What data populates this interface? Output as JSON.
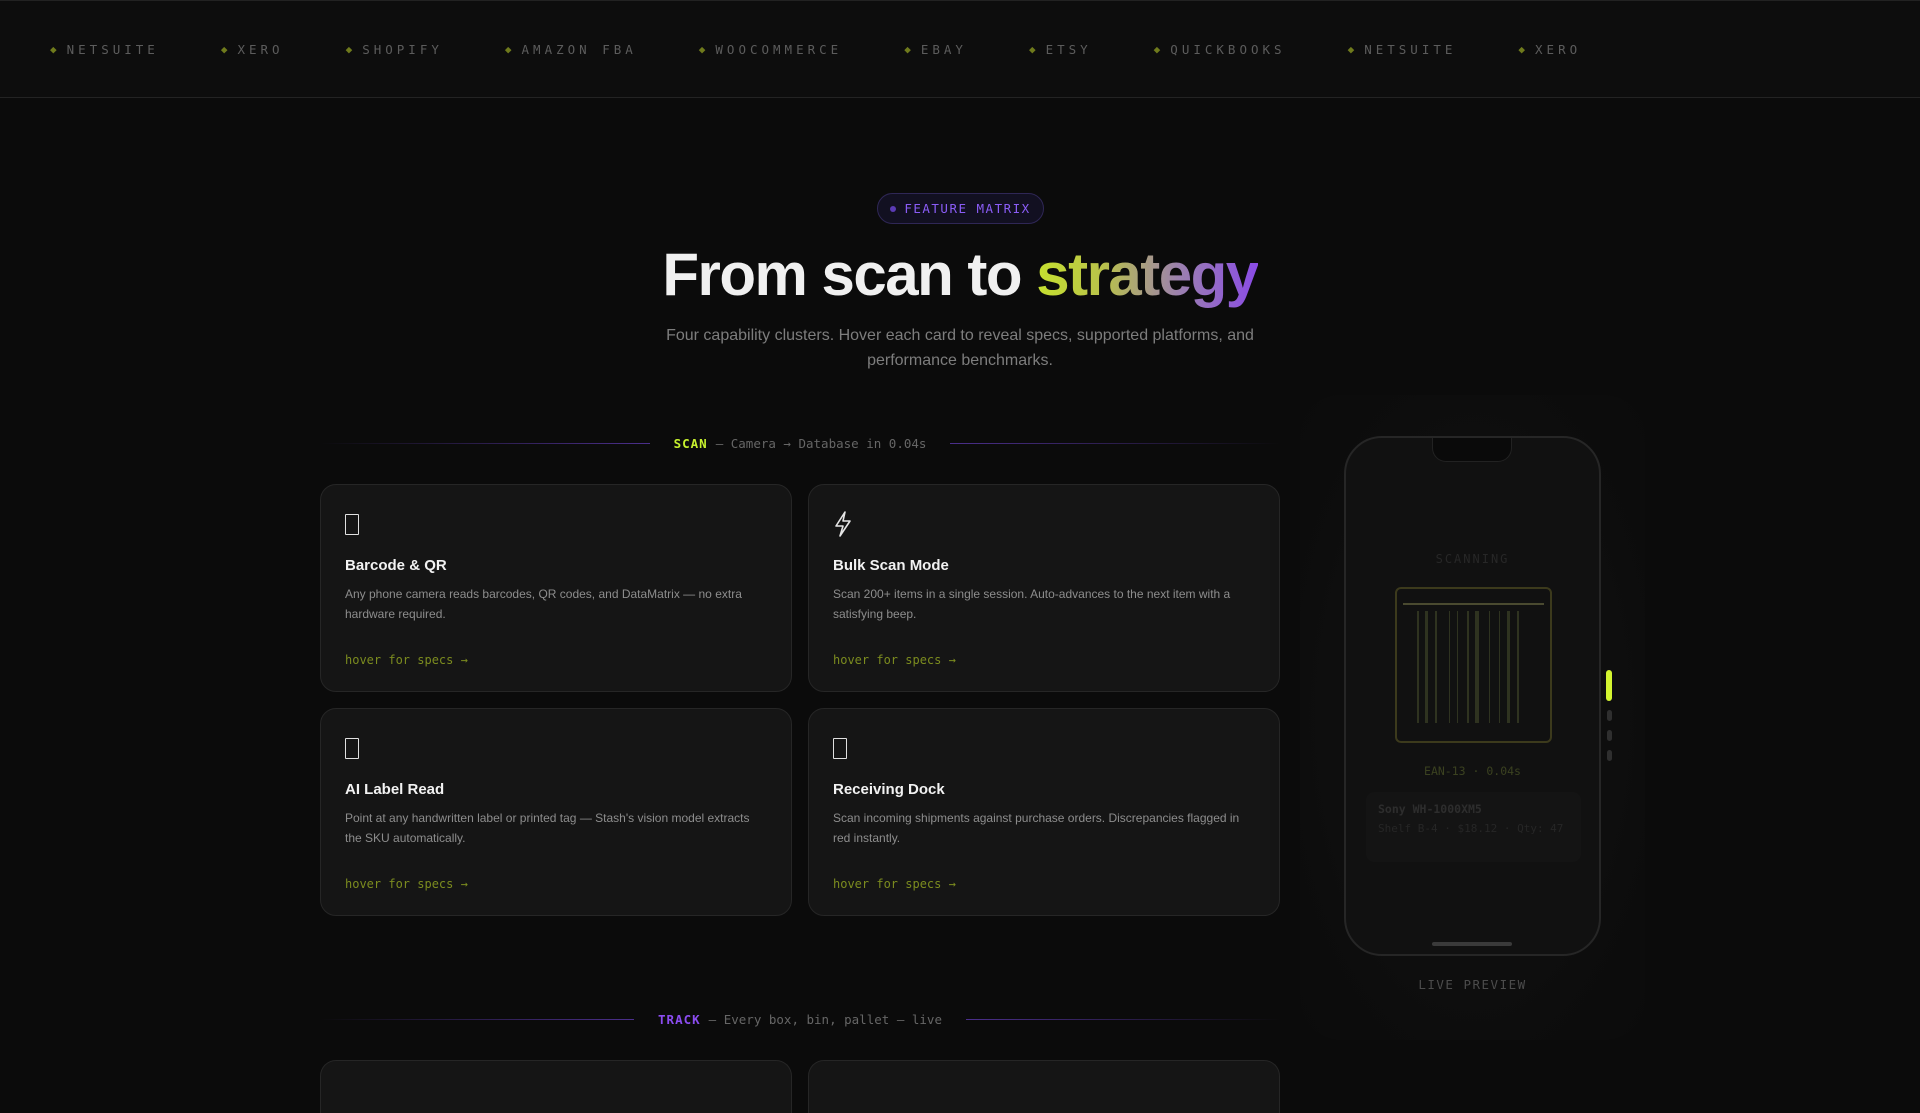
{
  "marquee": {
    "items": [
      "NETSUITE",
      "XERO",
      "SHOPIFY",
      "AMAZON FBA",
      "WOOCOMMERCE",
      "EBAY",
      "ETSY",
      "QUICKBOOKS",
      "NETSUITE",
      "XERO"
    ],
    "bullet_icon": "diamond-icon"
  },
  "hero": {
    "badge": "FEATURE MATRIX",
    "headline_plain": "From scan to ",
    "headline_accent": "strategy",
    "subline": "Four capability clusters. Hover each card to reveal specs, supported platforms, and performance benchmarks."
  },
  "sections": {
    "scan": {
      "tag": "SCAN",
      "caption": "— Camera → Database in 0.04s"
    },
    "track": {
      "tag": "TRACK",
      "caption": "— Every box, bin, pallet — live"
    }
  },
  "cards": [
    {
      "icon": "phone-icon",
      "title": "Barcode & QR",
      "desc": "Any phone camera reads barcodes, QR codes, and DataMatrix — no extra hardware required.",
      "link": "hover for specs →"
    },
    {
      "icon": "lightning-icon",
      "title": "Bulk Scan Mode",
      "desc": "Scan 200+ items in a single session. Auto-advances to the next item with a satisfying beep.",
      "link": "hover for specs →"
    },
    {
      "icon": "label-icon",
      "title": "AI Label Read",
      "desc": "Point at any handwritten label or printed tag — Stash's vision model extracts the SKU automatically.",
      "link": "hover for specs →"
    },
    {
      "icon": "dock-icon",
      "title": "Receiving Dock",
      "desc": "Scan incoming shipments against purchase orders. Discrepancies flagged in red instantly.",
      "link": "hover for specs →"
    }
  ],
  "preview": {
    "status": "SCANNING",
    "code_readout": "EAN-13 · 0.04s",
    "product_name": "Sony WH-1000XM5",
    "product_meta": "Shelf B-4 · $18.12 · Qty: 47",
    "caption": "LIVE PREVIEW",
    "active_step": 1,
    "total_steps": 4
  },
  "colors": {
    "accent_lime": "#c6f02e",
    "accent_purple": "#8b4cf0",
    "background": "#0b0b0b",
    "card_bg": "#151515"
  }
}
